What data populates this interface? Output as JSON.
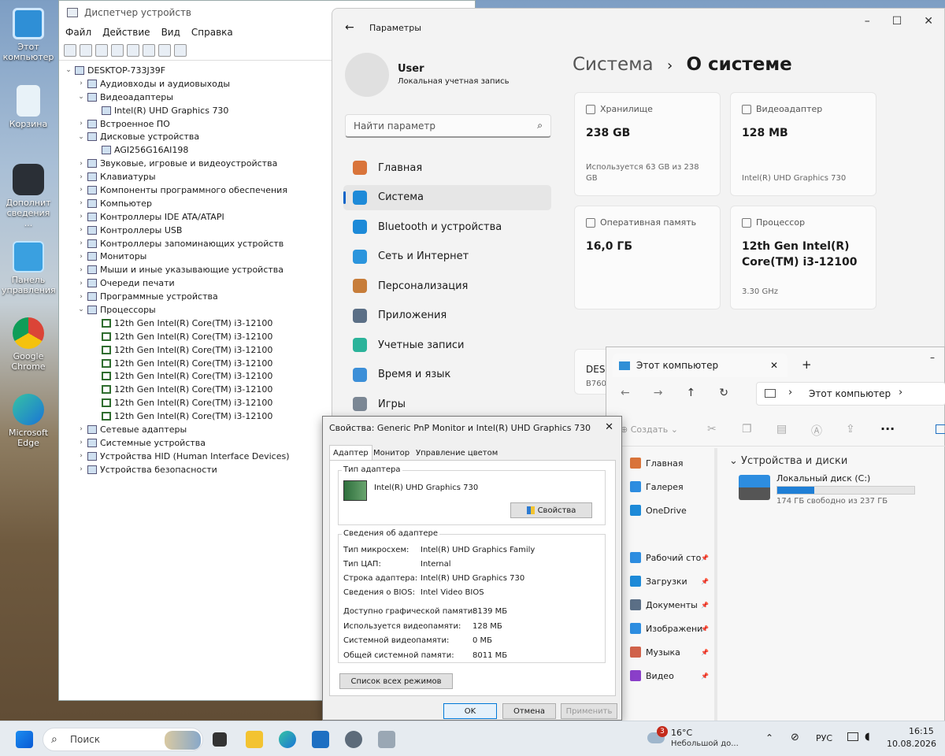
{
  "desktop": {
    "icons": [
      {
        "label": "Этот компьютер"
      },
      {
        "label": "Корзина"
      },
      {
        "label": "Дополнит сведения ..."
      },
      {
        "label": "Панель управления"
      },
      {
        "label": "Google Chrome"
      },
      {
        "label": "Microsoft Edge"
      }
    ]
  },
  "device_manager": {
    "title": "Диспетчер устройств",
    "menu": [
      "Файл",
      "Действие",
      "Вид",
      "Справка"
    ],
    "root": "DESKTOP-733J39F",
    "nodes": [
      {
        "label": "Аудиовходы и аудиовыходы",
        "level": 1,
        "arrow": "›"
      },
      {
        "label": "Видеоадаптеры",
        "level": 1,
        "arrow": "⌄"
      },
      {
        "label": "Intel(R) UHD Graphics 730",
        "level": 2,
        "arrow": ""
      },
      {
        "label": "Встроенное ПО",
        "level": 1,
        "arrow": "›"
      },
      {
        "label": "Дисковые устройства",
        "level": 1,
        "arrow": "⌄"
      },
      {
        "label": "AGI256G16AI198",
        "level": 2,
        "arrow": ""
      },
      {
        "label": "Звуковые, игровые и видеоустройства",
        "level": 1,
        "arrow": "›"
      },
      {
        "label": "Клавиатуры",
        "level": 1,
        "arrow": "›"
      },
      {
        "label": "Компоненты программного обеспечения",
        "level": 1,
        "arrow": "›"
      },
      {
        "label": "Компьютер",
        "level": 1,
        "arrow": "›"
      },
      {
        "label": "Контроллеры IDE ATA/ATAPI",
        "level": 1,
        "arrow": "›"
      },
      {
        "label": "Контроллеры USB",
        "level": 1,
        "arrow": "›"
      },
      {
        "label": "Контроллеры запоминающих устройств",
        "level": 1,
        "arrow": "›"
      },
      {
        "label": "Мониторы",
        "level": 1,
        "arrow": "›"
      },
      {
        "label": "Мыши и иные указывающие устройства",
        "level": 1,
        "arrow": "›"
      },
      {
        "label": "Очереди печати",
        "level": 1,
        "arrow": "›"
      },
      {
        "label": "Программные устройства",
        "level": 1,
        "arrow": "›"
      },
      {
        "label": "Процессоры",
        "level": 1,
        "arrow": "⌄"
      },
      {
        "label": "12th Gen Intel(R) Core(TM) i3-12100",
        "level": 2,
        "arrow": "",
        "cpu": true
      },
      {
        "label": "12th Gen Intel(R) Core(TM) i3-12100",
        "level": 2,
        "arrow": "",
        "cpu": true
      },
      {
        "label": "12th Gen Intel(R) Core(TM) i3-12100",
        "level": 2,
        "arrow": "",
        "cpu": true
      },
      {
        "label": "12th Gen Intel(R) Core(TM) i3-12100",
        "level": 2,
        "arrow": "",
        "cpu": true
      },
      {
        "label": "12th Gen Intel(R) Core(TM) i3-12100",
        "level": 2,
        "arrow": "",
        "cpu": true
      },
      {
        "label": "12th Gen Intel(R) Core(TM) i3-12100",
        "level": 2,
        "arrow": "",
        "cpu": true
      },
      {
        "label": "12th Gen Intel(R) Core(TM) i3-12100",
        "level": 2,
        "arrow": "",
        "cpu": true
      },
      {
        "label": "12th Gen Intel(R) Core(TM) i3-12100",
        "level": 2,
        "arrow": "",
        "cpu": true
      },
      {
        "label": "Сетевые адаптеры",
        "level": 1,
        "arrow": "›"
      },
      {
        "label": "Системные устройства",
        "level": 1,
        "arrow": "›"
      },
      {
        "label": "Устройства HID (Human Interface Devices)",
        "level": 1,
        "arrow": "›"
      },
      {
        "label": "Устройства безопасности",
        "level": 1,
        "arrow": "›"
      }
    ]
  },
  "settings": {
    "app_title": "Параметры",
    "user_name": "User",
    "user_sub": "Локальная учетная запись",
    "search_placeholder": "Найти параметр",
    "breadcrumb_parent": "Система",
    "breadcrumb_sep": "›",
    "breadcrumb_current": "О системе",
    "nav": [
      {
        "label": "Главная",
        "color": "#d9743a"
      },
      {
        "label": "Система",
        "color": "#1d8ad8"
      },
      {
        "label": "Bluetooth и устройства",
        "color": "#1d8ad8"
      },
      {
        "label": "Сеть и Интернет",
        "color": "#2b95dd"
      },
      {
        "label": "Персонализация",
        "color": "#c77d3a"
      },
      {
        "label": "Приложения",
        "color": "#5b6f86"
      },
      {
        "label": "Учетные записи",
        "color": "#2bb39a"
      },
      {
        "label": "Время и язык",
        "color": "#3c8fd8"
      },
      {
        "label": "Игры",
        "color": "#7b8794"
      }
    ],
    "cards": [
      {
        "label": "Хранилище",
        "value": "238 GB",
        "sub": "Используется 63 GB из 238 GB"
      },
      {
        "label": "Видеоадаптер",
        "value": "128 MB",
        "sub": "Intel(R) UHD Graphics 730"
      },
      {
        "label": "Оперативная память",
        "value": "16,0 ГБ",
        "sub": ""
      },
      {
        "label": "Процессор",
        "value": "12th Gen Intel(R) Core(TM) i3-12100",
        "sub": "3.30 GHz"
      }
    ],
    "device_name_partial": "DESK",
    "device_model_partial": "B760"
  },
  "explorer": {
    "tab_title": "Этот компьютер",
    "address": "Этот компьютер",
    "new_button": "Создать",
    "sidebar": [
      "Главная",
      "Галерея",
      "OneDrive",
      "Рабочий сто",
      "Загрузки",
      "Документы",
      "Изображени",
      "Музыка",
      "Видео"
    ],
    "section": "Устройства и диски",
    "drive_name": "Локальный диск (C:)",
    "drive_free": "174 ГБ свободно из 237 ГБ",
    "drive_used_fraction": 0.27
  },
  "props": {
    "title": "Свойства: Generic PnP Monitor и Intel(R) UHD Graphics 730",
    "tabs": [
      "Адаптер",
      "Монитор",
      "Управление цветом"
    ],
    "adapter_type_label": "Тип адаптера",
    "adapter_name": "Intel(R) UHD Graphics 730",
    "properties_button": "Свойства",
    "info_label": "Сведения об адаптере",
    "rows": [
      {
        "k": "Тип микросхем:",
        "v": "Intel(R) UHD Graphics Family"
      },
      {
        "k": "Тип ЦАП:",
        "v": "Internal"
      },
      {
        "k": "Строка адаптера:",
        "v": "Intel(R) UHD Graphics 730"
      },
      {
        "k": "Сведения о BIOS:",
        "v": "Intel Video BIOS"
      }
    ],
    "mem_rows": [
      {
        "k": "Доступно графической памяти:",
        "v": "8139 МБ"
      },
      {
        "k": "Используется видеопамяти:",
        "v": "128 МБ"
      },
      {
        "k": "Системной видеопамяти:",
        "v": "0 МБ"
      },
      {
        "k": "Общей системной памяти:",
        "v": "8011 МБ"
      }
    ],
    "list_modes_button": "Список всех режимов",
    "ok": "OK",
    "cancel": "Отмена",
    "apply": "Применить"
  },
  "taskbar": {
    "search_placeholder": "Поиск",
    "weather_temp": "16°C",
    "weather_desc": "Небольшой до...",
    "weather_badge": "3",
    "lang": "РУС",
    "time": "16:15",
    "date": "10.08.2026"
  }
}
